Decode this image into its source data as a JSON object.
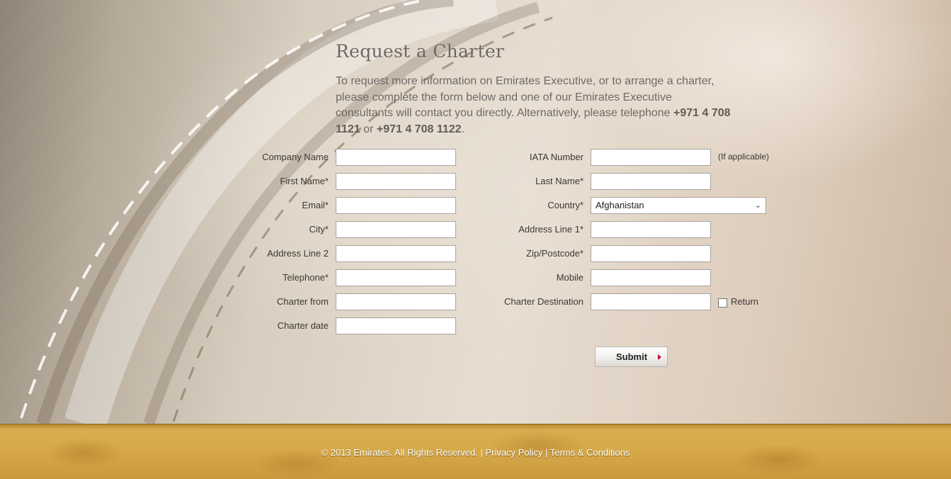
{
  "page": {
    "title": "Request a Charter",
    "intro_text": "To request more information on Emirates Executive, or to arrange a charter, please complete the form below and one of our Emirates Executive consultants will contact you directly. Alternatively, please telephone ",
    "phone_1": "+971 4 708 1121",
    "intro_or": " or ",
    "phone_2": "+971 4 708 1122",
    "intro_end": "."
  },
  "form": {
    "left": [
      {
        "label": "Company Name",
        "value": ""
      },
      {
        "label": "First Name*",
        "value": ""
      },
      {
        "label": "Email*",
        "value": ""
      },
      {
        "label": "City*",
        "value": ""
      },
      {
        "label": "Address Line 2",
        "value": ""
      },
      {
        "label": "Telephone*",
        "value": ""
      },
      {
        "label": "Charter from",
        "value": ""
      },
      {
        "label": "Charter date",
        "value": ""
      }
    ],
    "right": [
      {
        "label": "IATA Number",
        "value": ""
      },
      {
        "label": "Last Name*",
        "value": ""
      },
      {
        "label": "Country*",
        "value": "Afghanistan"
      },
      {
        "label": "Address Line 1*",
        "value": ""
      },
      {
        "label": "Zip/Postcode*",
        "value": ""
      },
      {
        "label": "Mobile",
        "value": ""
      },
      {
        "label": "Charter Destination",
        "value": ""
      }
    ],
    "iata_note": "(If applicable)",
    "return_label": "Return",
    "return_checked": false,
    "submit_label": "Submit"
  },
  "footer": {
    "copyright": "© 2013 Emirates. All Rights Reserved.",
    "sep": " | ",
    "privacy_label": "Privacy Policy",
    "terms_label": "Terms & Conditions"
  },
  "colors": {
    "accent_arrow": "#c8102e",
    "footer_gold": "#d6a848"
  }
}
